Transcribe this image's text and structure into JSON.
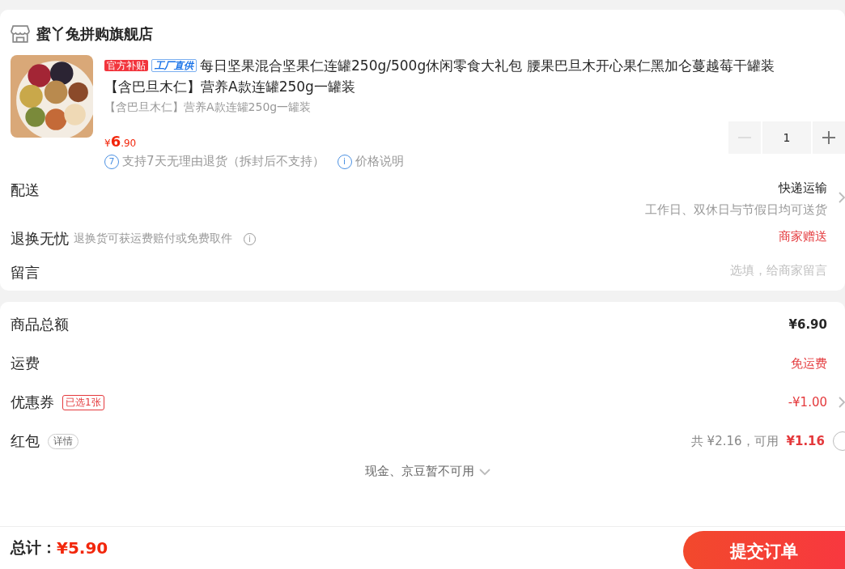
{
  "shop": {
    "name": "蜜丫兔拼购旗舰店"
  },
  "product": {
    "tags": [
      {
        "text": "官方补贴",
        "kind": "solid"
      },
      {
        "text": "工厂直供",
        "kind": "outline"
      }
    ],
    "title_lines": [
      "每日坚果混合坚果仁连罐250g/500g休闲零食大礼包 腰果巴旦木开心果仁黑加仑蔓越莓干罐装",
      "【含巴旦木仁】营养A款连罐250g一罐装"
    ],
    "spec": "【含巴旦木仁】营养A款连罐250g一罐装",
    "price_symbol": "¥",
    "price_int": "6",
    "price_dec": ".90",
    "quantity": "1",
    "minus_disabled": true,
    "notes": [
      {
        "icon": "7",
        "text": "支持7天无理由退货（拆封后不支持）"
      },
      {
        "icon": "i",
        "text": "价格说明"
      }
    ]
  },
  "options": [
    {
      "label": "配送",
      "value": "快递运输",
      "sub": "工作日、双休日与节假日均可送货",
      "red": false,
      "chevron": true
    },
    {
      "label": "退换无忧",
      "hint": "退换货可获运费赔付或免费取件",
      "info_icon": "i",
      "value": "商家赠送",
      "red": true,
      "chevron": false
    },
    {
      "label": "留言",
      "placeholder": "选填，给商家留言",
      "chevron": false
    }
  ],
  "summary": [
    {
      "label": "商品总额",
      "value": "¥6.90",
      "red": false,
      "bold": true,
      "chevron": false
    },
    {
      "label": "运费",
      "value": "免运费",
      "red": true,
      "bold": false,
      "chevron": false
    },
    {
      "label": "优惠券",
      "badge": {
        "text": "已选1张",
        "kind": "outline"
      },
      "value": "-¥1.00",
      "red": true,
      "bold": false,
      "chevron": true
    },
    {
      "label": "红包",
      "badge": {
        "text": "详情",
        "kind": "pill"
      },
      "value_prefix": "共 ¥2.16，可用",
      "value": "¥1.16",
      "red": true,
      "bold": true,
      "chevron": false,
      "radio": {
        "selected": false
      }
    }
  ],
  "expander": "现金、京豆暂不可用",
  "footer": {
    "total_label": "总计：",
    "total": "¥5.90",
    "submit": "提交订单"
  }
}
